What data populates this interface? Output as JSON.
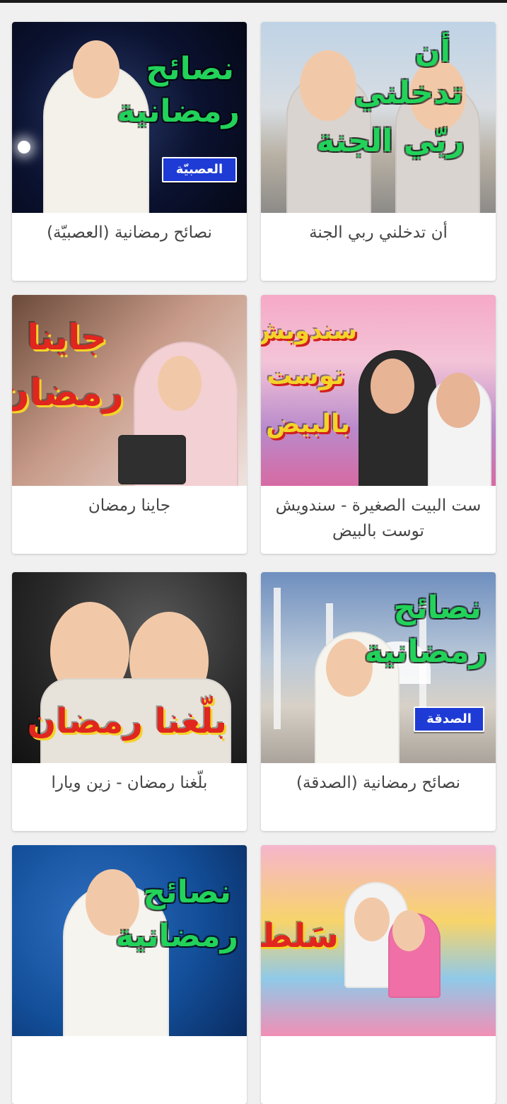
{
  "ui": {
    "cards": [
      {
        "id": "card-1",
        "title": "أن تدخلني ربي الجنة",
        "thumbnail": {
          "lines": [
            "أن",
            "تدخلني",
            "ربّي الجنة"
          ]
        }
      },
      {
        "id": "card-2",
        "title": "نصائح رمضانية (العصبيّة)",
        "thumbnail": {
          "lines": [
            "نصائح",
            "رمضانية"
          ],
          "badge": "العصبيّة"
        }
      },
      {
        "id": "card-3",
        "title": "ست البيت الصغيرة - سندويش توست بالبيض",
        "thumbnail": {
          "lines": [
            "سندويش",
            "توست",
            "بالبيض"
          ]
        }
      },
      {
        "id": "card-4",
        "title": "جاينا رمضان",
        "thumbnail": {
          "lines": [
            "جاينا",
            "رمضان"
          ]
        }
      },
      {
        "id": "card-5",
        "title": "نصائح رمضانية (الصدقة)",
        "thumbnail": {
          "lines": [
            "نصائح",
            "رمضانية"
          ],
          "badge": "الصدقة"
        }
      },
      {
        "id": "card-6",
        "title": "بلّغنا رمضان - زين ويارا",
        "thumbnail": {
          "lines": [
            "بلّغنا رمضان"
          ]
        }
      },
      {
        "id": "card-7",
        "title": "",
        "thumbnail": {
          "lines": [
            "سَلطة"
          ]
        }
      },
      {
        "id": "card-8",
        "title": "",
        "thumbnail": {
          "lines": [
            "نصائح",
            "رمضانية"
          ]
        }
      }
    ]
  },
  "colors": {
    "page_background": "#f0f0f0",
    "card_background": "#ffffff",
    "title_text": "#444444",
    "top_bar": "#1a1a1a",
    "green_text": "#22d25a",
    "badge_blue": "#1e3bd6"
  },
  "icons": {
    "top_bar": "status-bar-strip"
  }
}
